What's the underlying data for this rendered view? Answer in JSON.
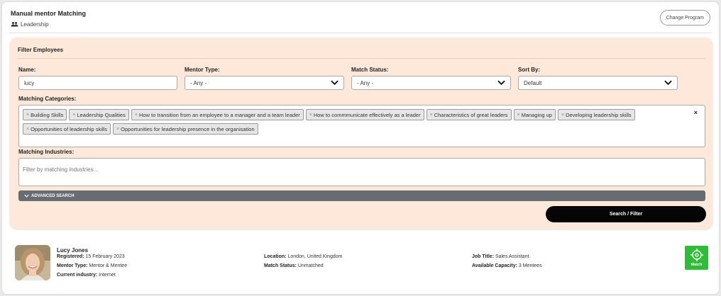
{
  "header": {
    "title": "Manual mentor Matching",
    "program": "Leadership",
    "change_button": "Change Program"
  },
  "filter": {
    "title": "Filter Employees",
    "name_label": "Name:",
    "name_value": "lucy",
    "mentor_type_label": "Mentor Type:",
    "mentor_type_value": "- Any -",
    "match_status_label": "Match Status:",
    "match_status_value": "- Any -",
    "sort_by_label": "Sort By:",
    "sort_by_value": "Default",
    "categories_label": "Matching Categories:",
    "categories": [
      "Building Skills",
      "Leadership Qualities",
      "How to transition from an employee to a manager and a team leader",
      "How to commmunicate effectively as a leader",
      "Characteristics of great leaders",
      "Managing up",
      "Developing leadership skills",
      "Opportunities of leadership skills",
      "Opportunities for leadership presence in the organisation"
    ],
    "tag_remove_glyph": "×",
    "clear_glyph": "×",
    "industries_label": "Matching Industries:",
    "industries_placeholder": "Filter by matching industries...",
    "advanced_search": "ADVANCED SEARCH",
    "search_button": "Search / Filter"
  },
  "result": {
    "name": "Lucy Jones",
    "registered_label": "Registered:",
    "registered_value": "15 February 2023",
    "mentor_type_label": "Mentor Type:",
    "mentor_type_value": "Mentor & Mentee",
    "industry_label": "Current industry:",
    "industry_value": "Internet",
    "location_label": "Location:",
    "location_value": "London, United Kingdom",
    "match_status_label": "Match Status:",
    "match_status_value": "Unmatched",
    "job_title_label": "Job Title:",
    "job_title_value": "Sales Assistant",
    "capacity_label": "Available Capacity:",
    "capacity_value": "3 Mentees",
    "match_button": "Match"
  },
  "colors": {
    "filter_bg": "#fde8da",
    "match_green": "#2ebd35",
    "advanced_bar": "#676b72",
    "search_button": "#050505"
  }
}
